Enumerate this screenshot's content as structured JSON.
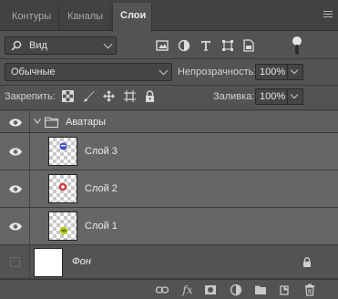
{
  "tabs": [
    {
      "label": "Контуры",
      "active": false
    },
    {
      "label": "Каналы",
      "active": false
    },
    {
      "label": "Слои",
      "active": true
    }
  ],
  "filter": {
    "kind_label": "Вид",
    "icons": [
      "image-filter-icon",
      "adjustment-filter-icon",
      "type-filter-icon",
      "shape-filter-icon",
      "smart-object-filter-icon"
    ]
  },
  "blend": {
    "mode": "Обычные",
    "opacity_label": "Непрозрачность:",
    "opacity_value": "100%"
  },
  "lock": {
    "label": "Закрепить:",
    "fill_label": "Заливка:",
    "fill_value": "100%"
  },
  "group": {
    "name": "Аватары"
  },
  "layers": [
    {
      "name": "Слой 3",
      "dot_color": "#3e4fc4"
    },
    {
      "name": "Слой 2",
      "dot_color": "#d23c3c"
    },
    {
      "name": "Слой 1",
      "dot_color": "#b6c81e"
    }
  ],
  "background_layer": {
    "name": "Фон"
  },
  "footer_icons": [
    "link-icon",
    "fx-icon",
    "mask-icon",
    "adjustment-icon",
    "folder-icon",
    "new-layer-icon",
    "trash-icon"
  ]
}
